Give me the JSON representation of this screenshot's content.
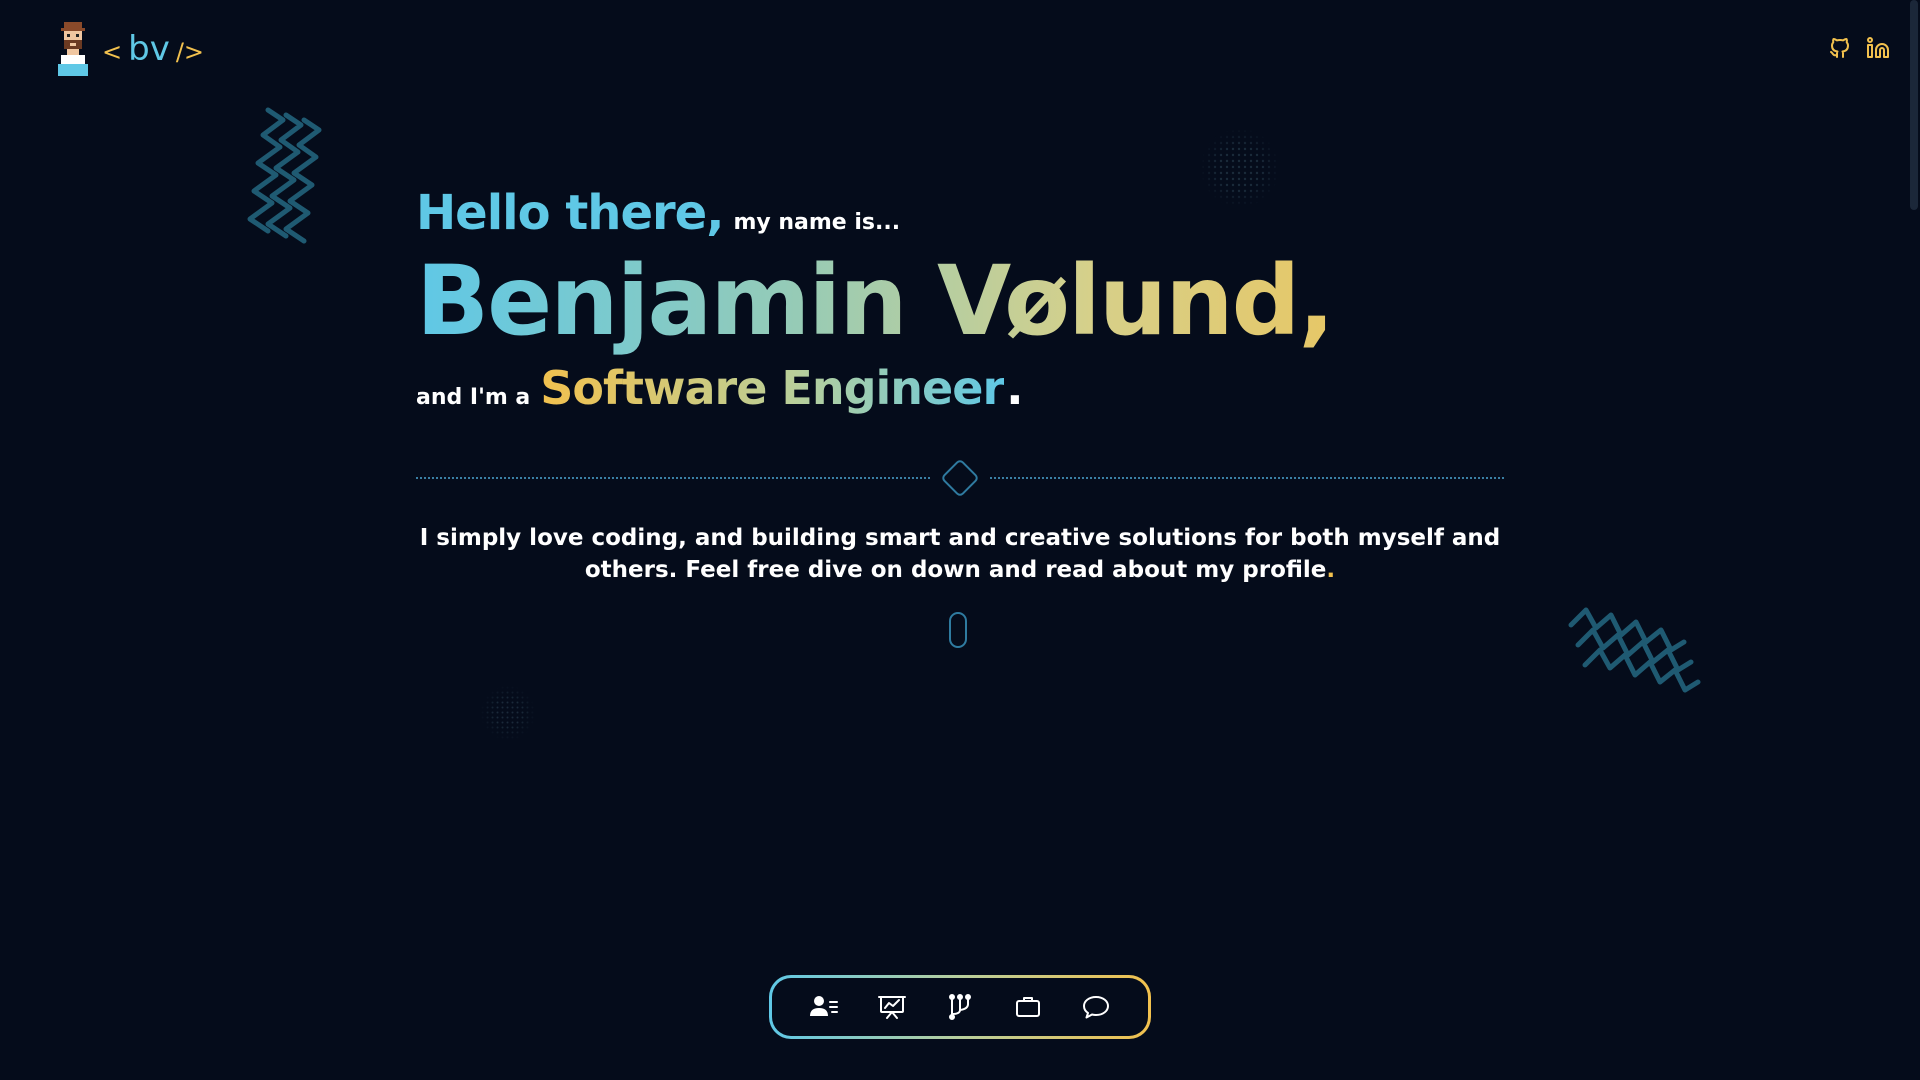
{
  "header": {
    "logo_open": "<",
    "logo_name": "bv",
    "logo_close": "/>",
    "social": [
      {
        "icon": "github-icon"
      },
      {
        "icon": "linkedin-icon"
      }
    ]
  },
  "hero": {
    "greeting": "Hello there,",
    "greeting_tail": "my name is...",
    "name": "Benjamin Vølund,",
    "role_prefix": "and I'm a",
    "role": "Software Engineer",
    "role_suffix": "."
  },
  "intro": {
    "text": "I simply love coding, and building smart and creative solutions for both myself and others. Feel free dive on down and read about my profile",
    "end": "."
  },
  "nav": {
    "items": [
      {
        "icon": "profile-icon"
      },
      {
        "icon": "presentation-icon"
      },
      {
        "icon": "git-branches-icon"
      },
      {
        "icon": "briefcase-icon"
      },
      {
        "icon": "chat-bubble-icon"
      }
    ]
  },
  "colors": {
    "background": "#050c1b",
    "accent_blue": "#5fc8e6",
    "accent_yellow": "#f2c14e",
    "line_blue": "#2f7ba0"
  }
}
